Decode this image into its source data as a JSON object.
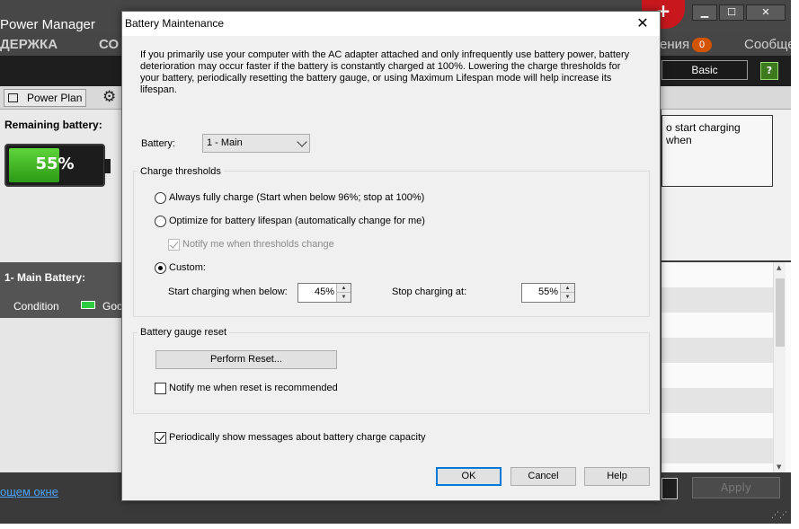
{
  "app": {
    "title": "Power Manager",
    "menu": [
      "ДЕРЖКА",
      "СО",
      "ения",
      "Сообще"
    ],
    "notification_count": "0",
    "mode_button": "Basic",
    "help_icon_label": "?",
    "logo_icon": "lenovo-logo-icon",
    "tab_power_plan": "Power Plan",
    "remaining_label": "Remaining battery:",
    "battery_percent": "55%",
    "battery_level": 0.55,
    "main_battery_title": "1- Main Battery:",
    "condition_label": "Condition",
    "condition_value": "Goo",
    "right_box_text": "o start charging when",
    "bottom_link": "ощем окне",
    "apply_button": "Apply",
    "accent": "#c8181e"
  },
  "dialog": {
    "title": "Battery Maintenance",
    "intro": "If you primarily use your computer with the AC adapter attached and only infrequently use battery power, battery deterioration may occur faster if the battery is constantly charged at 100%. Lowering the charge thresholds for your battery, periodically resetting the battery gauge, or using Maximum Lifespan mode will help increase its lifespan.",
    "battery_label": "Battery:",
    "battery_selected": "1 - Main",
    "charge_thresholds": {
      "legend": "Charge thresholds",
      "option_full": "Always fully charge (Start when below 96%; stop at 100%)",
      "option_optimize": "Optimize for battery lifespan (automatically change for me)",
      "notify_thresholds": "Notify me when thresholds change",
      "option_custom": "Custom:",
      "start_label": "Start charging when below:",
      "start_value": "45%",
      "stop_label": "Stop charging at:",
      "stop_value": "55%"
    },
    "gauge_reset": {
      "legend": "Battery gauge reset",
      "perform_button": "Perform Reset...",
      "notify_reset": "Notify me when reset is recommended"
    },
    "periodic_messages": "Periodically show messages about battery charge capacity",
    "ok": "OK",
    "cancel": "Cancel",
    "help": "Help"
  }
}
